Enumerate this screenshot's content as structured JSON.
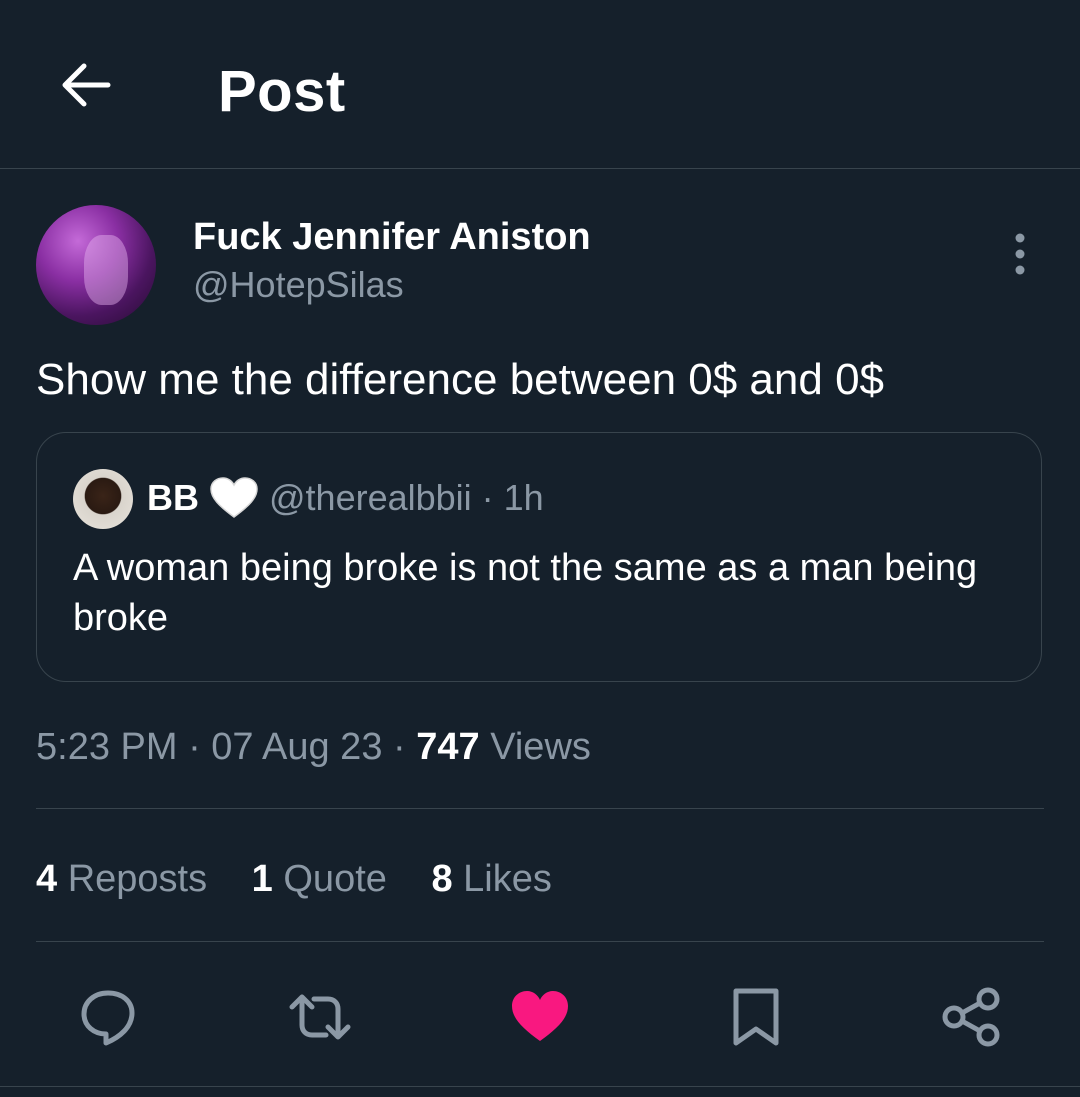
{
  "header": {
    "title": "Post",
    "back_icon": "arrow-left-icon"
  },
  "author": {
    "name": "Fuck Jennifer Aniston",
    "handle": "@HotepSilas"
  },
  "tweet": {
    "text": "Show me the difference between 0$ and 0$"
  },
  "quote": {
    "name": "BB",
    "emoji": "white-heart-icon",
    "handle_time": "@therealbbii · 1h",
    "text": "A woman being broke is not the same as a man being broke"
  },
  "meta": {
    "time_date": "5:23 PM · 07 Aug 23 · ",
    "views_count": "747",
    "views_label": "Views"
  },
  "stats": {
    "reposts": {
      "count": "4",
      "label": "Reposts"
    },
    "quotes": {
      "count": "1",
      "label": "Quote"
    },
    "likes": {
      "count": "8",
      "label": "Likes"
    }
  },
  "actions": [
    "reply-icon",
    "repost-icon",
    "like-icon",
    "bookmark-icon",
    "share-icon"
  ],
  "colors": {
    "background": "#15202b",
    "border": "#38444d",
    "secondary_text": "#8b98a5",
    "like_active": "#f91880"
  }
}
